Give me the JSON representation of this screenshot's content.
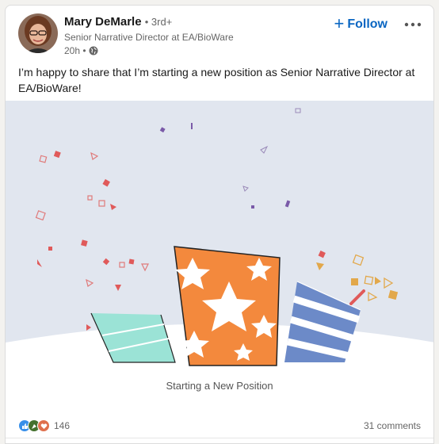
{
  "author": {
    "name": "Mary DeMarle",
    "degree": "• 3rd+",
    "headline": "Senior Narrative Director at EA/BioWare",
    "time": "20h •"
  },
  "actions": {
    "follow_label": "Follow",
    "more_icon": "more-horizontal-icon"
  },
  "post": {
    "text": "I’m happy to share that I’m starting a new position as Senior Narrative Director at EA/BioWare!"
  },
  "media": {
    "caption": "Starting a New Position"
  },
  "social": {
    "reactions": [
      "like",
      "celebrate",
      "love"
    ],
    "reaction_count": "146",
    "comments": "31 comments"
  },
  "colors": {
    "accent": "#0a66c2",
    "media_bg": "#e1e6ef",
    "gift_orange": "#f3893d",
    "gift_blue": "#6c8ac8",
    "gift_teal": "#9be3d6",
    "confetti_red": "#e05a5a",
    "confetti_gold": "#e2a84b",
    "confetti_purple": "#7a5aa8"
  }
}
